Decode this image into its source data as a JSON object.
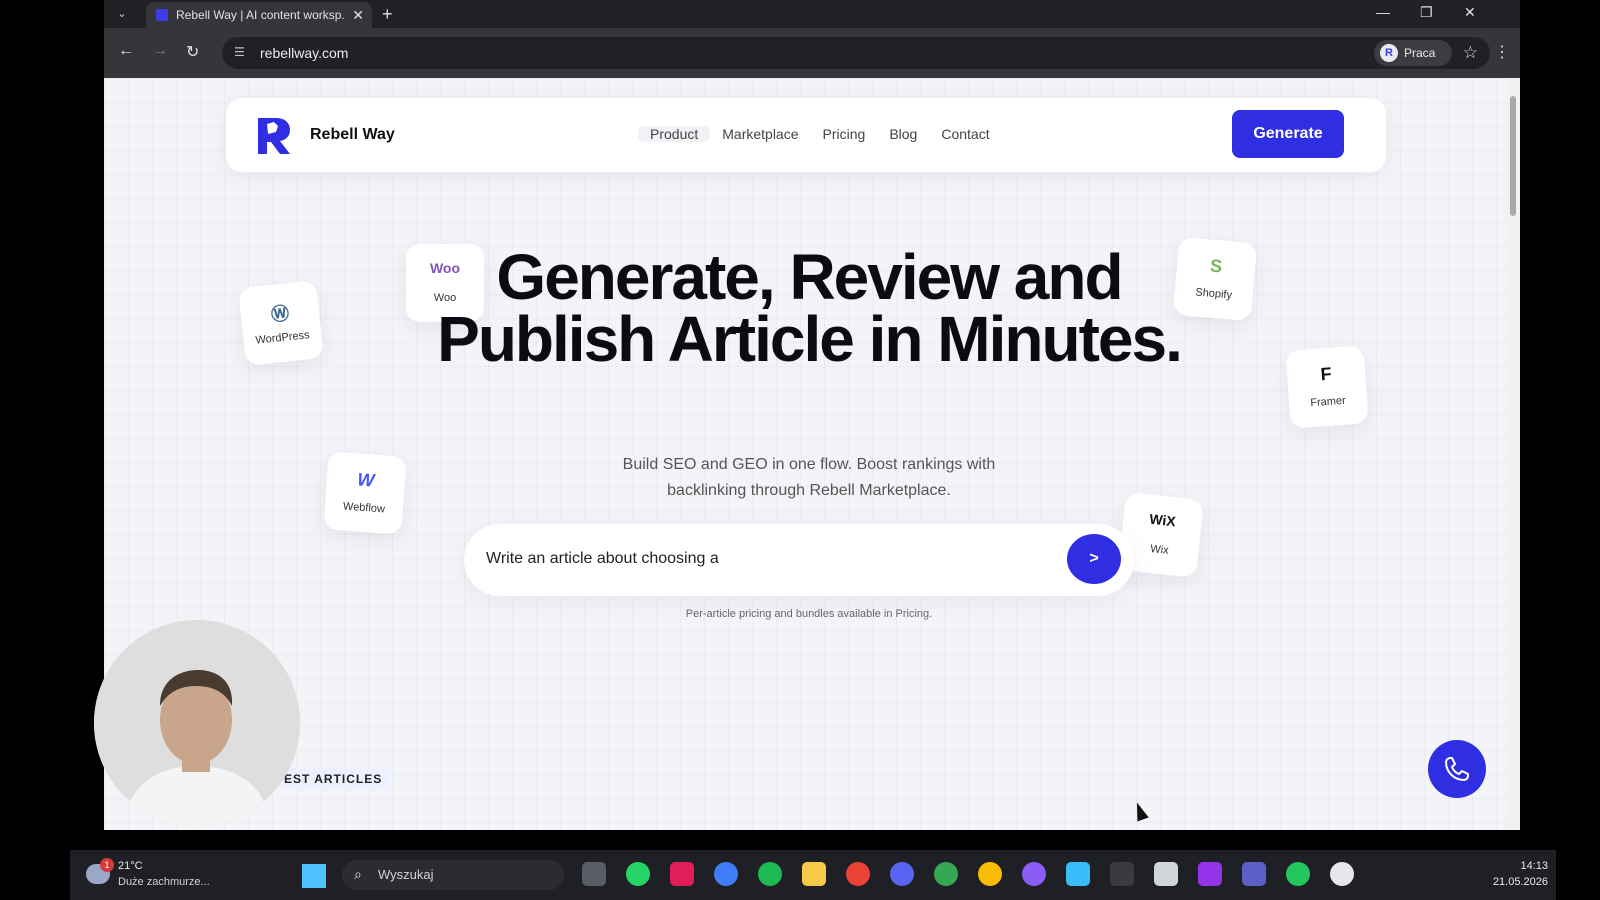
{
  "browser": {
    "tab_title": "Rebell Way | AI content worksp...",
    "url": "rebellway.com",
    "profile_name": "Praca"
  },
  "site": {
    "logo_text": "Rebell Way",
    "nav": [
      "Product",
      "Marketplace",
      "Pricing",
      "Blog",
      "Contact"
    ],
    "cta": "Generate",
    "hero_title": "Generate, Review and Publish Article in Minutes.",
    "hero_sub": "Build SEO and GEO in one flow. Boost rankings with backlinking through Rebell Marketplace.",
    "prompt_value": "Write an article about choosing a",
    "send_label": ">",
    "note": "Per-article pricing and bundles available in Pricing.",
    "section_label": "EST ARTICLES",
    "platforms": [
      {
        "label": "WordPress",
        "icon": "W"
      },
      {
        "label": "Woo",
        "icon": "Woo"
      },
      {
        "label": "Webflow",
        "icon": "W"
      },
      {
        "label": "Shopify",
        "icon": "S"
      },
      {
        "label": "Framer",
        "icon": "F"
      },
      {
        "label": "Wix",
        "icon": "WiX"
      }
    ],
    "accent": "#2f2ee3"
  },
  "taskbar": {
    "temperature": "21°C",
    "condition": "Duże zachmurze...",
    "weather_badge": "1",
    "search_placeholder": "Wyszukaj",
    "time": "14:13",
    "date": "21.05.2026"
  }
}
